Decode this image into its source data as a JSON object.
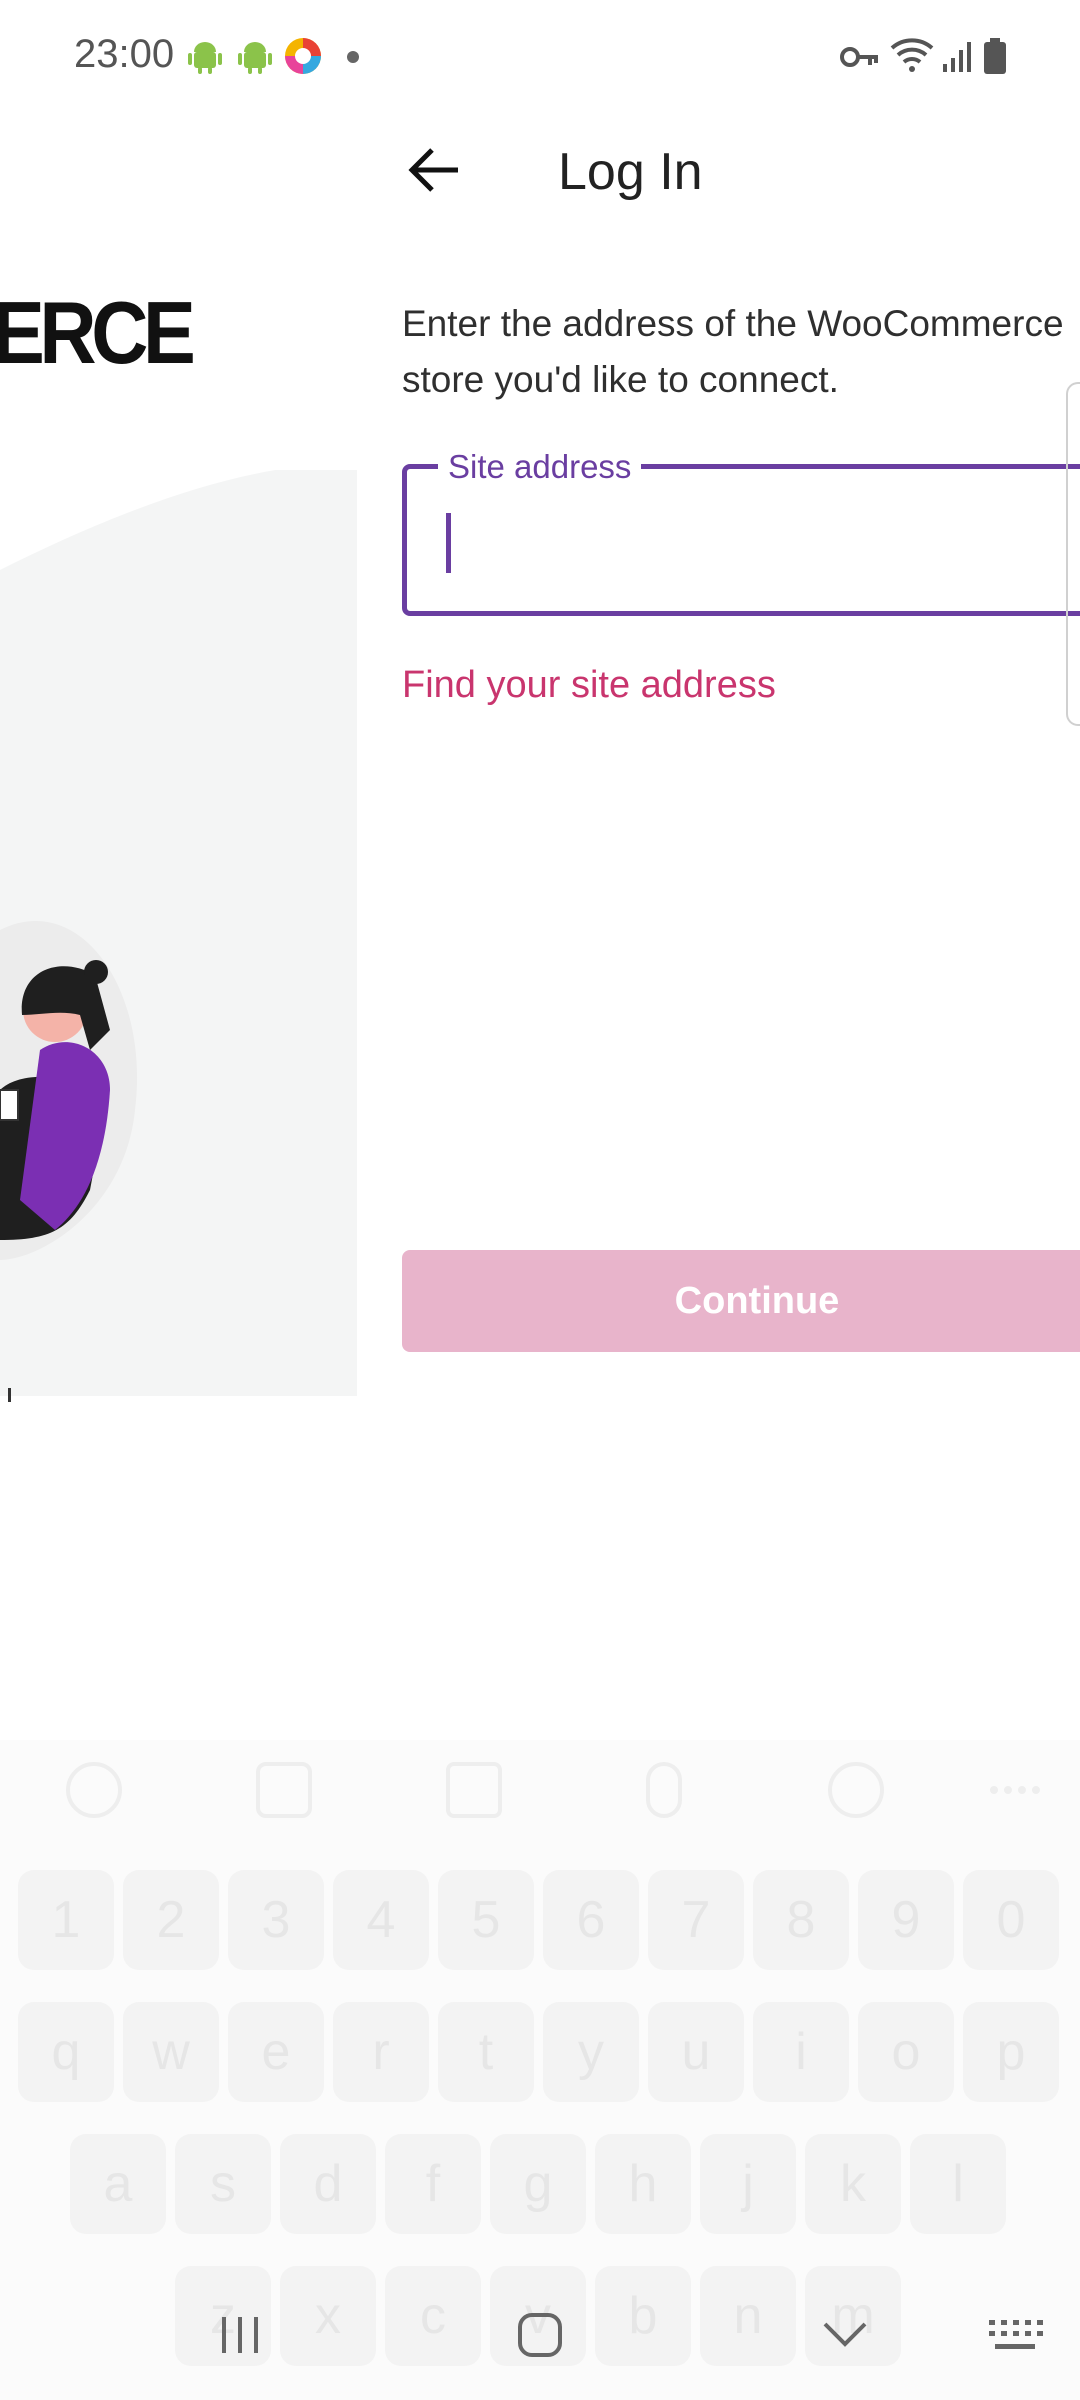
{
  "status_bar": {
    "time": "23:00",
    "icons": [
      "android-icon",
      "android-icon",
      "browser-icon",
      "notification-dot",
      "vpn-key-icon",
      "wifi-icon",
      "signal-icon",
      "battery-icon"
    ]
  },
  "left_panel": {
    "brand_fragment": "ERCE"
  },
  "app_bar": {
    "title": "Log In",
    "back_icon": "arrow-left-icon"
  },
  "form": {
    "instructions": "Enter the address of the WooCommerce store you'd like to connect.",
    "site_address_label": "Site address",
    "site_address_value": "",
    "find_link": "Find your site address",
    "continue_label": "Continue"
  },
  "keyboard": {
    "row_numbers": [
      "1",
      "2",
      "3",
      "4",
      "5",
      "6",
      "7",
      "8",
      "9",
      "0"
    ],
    "row_top": [
      "q",
      "w",
      "e",
      "r",
      "t",
      "y",
      "u",
      "i",
      "o",
      "p"
    ],
    "row_mid": [
      "a",
      "s",
      "d",
      "f",
      "g",
      "h",
      "j",
      "k",
      "l"
    ],
    "row_bottom": [
      "z",
      "x",
      "c",
      "v",
      "b",
      "n",
      "m"
    ]
  },
  "nav_bar": {
    "icons": [
      "recent-apps-icon",
      "home-icon",
      "hide-keyboard-icon",
      "keyboard-icon"
    ]
  },
  "colors": {
    "accent_purple": "#6a3ea1",
    "link_pink": "#c9356e",
    "button_disabled": "#e8b4cb"
  }
}
